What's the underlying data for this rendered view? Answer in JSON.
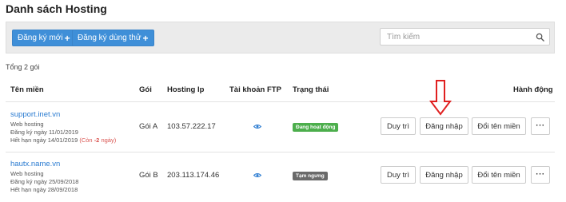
{
  "page": {
    "title": "Danh sách Hosting"
  },
  "toolbar": {
    "register_label": "Đăng ký mới",
    "trial_label": "Đăng ký dùng thử",
    "plus_glyph": "+",
    "search_placeholder": "Tìm kiếm"
  },
  "summary": {
    "total": "Tổng 2 gói"
  },
  "table": {
    "headers": {
      "domain": "Tên miền",
      "plan": "Gói",
      "ip": "Hosting Ip",
      "ftp": "Tài khoản FTP",
      "status": "Trạng thái",
      "actions": "Hành động"
    },
    "rows": [
      {
        "domain": "support.inet.vn",
        "type": "Web hosting",
        "registered": "Đăng ký ngày 11/01/2019",
        "expires": "Hết hạn ngày 14/01/2019",
        "remaining_open": "(Còn ",
        "remaining_days": "-2",
        "remaining_close": " ngày)",
        "plan": "Gói A",
        "ip": "103.57.222.17",
        "status": "Đang hoạt động",
        "status_color": "#4cae4c",
        "btn_renew": "Duy trì",
        "btn_login": "Đăng nhập",
        "btn_rename": "Đổi tên miền",
        "btn_more": "···"
      },
      {
        "domain": "hautx.name.vn",
        "type": "Web hosting",
        "registered": "Đăng ký ngày 25/09/2018",
        "expires": "Hết hạn ngày 28/09/2018",
        "plan": "Gói B",
        "ip": "203.113.174.46",
        "status": "Tạm ngưng",
        "status_color": "#6a6a6a",
        "btn_renew": "Duy trì",
        "btn_login": "Đăng nhập",
        "btn_rename": "Đổi tên miền",
        "btn_more": "···"
      }
    ]
  },
  "colors": {
    "primary": "#3f8fd8",
    "link": "#2a7bd1",
    "warn": "#d9534f",
    "annotation": "#e02020"
  },
  "icons": {
    "search": "search-icon",
    "ftp": "eye-icon",
    "annotation": "down-arrow-icon"
  }
}
